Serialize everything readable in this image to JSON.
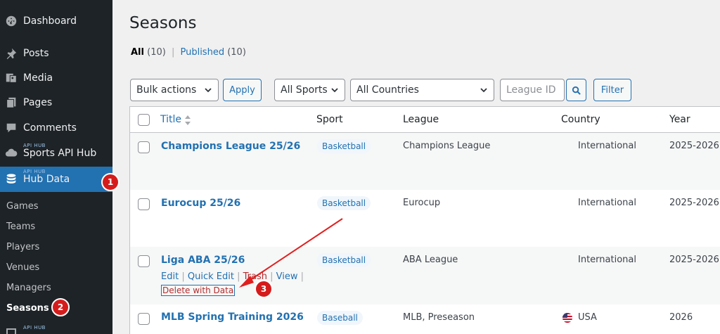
{
  "sidebar": {
    "dashboard": "Dashboard",
    "posts": "Posts",
    "media": "Media",
    "pages": "Pages",
    "comments": "Comments",
    "sports_api_hub_mini": "API HUB",
    "sports_api_hub": "Sports API Hub",
    "hub_data_mini": "API HUB",
    "hub_data": "Hub Data",
    "bottom_mini": "API HUB",
    "submenu": [
      "Games",
      "Teams",
      "Players",
      "Venues",
      "Managers",
      "Seasons"
    ],
    "current_submenu": "Seasons"
  },
  "badges": [
    "1",
    "2",
    "3"
  ],
  "page": {
    "title": "Seasons",
    "views": {
      "all_label": "All",
      "all_count": "(10)",
      "separator": "|",
      "published_label": "Published",
      "published_count": "(10)"
    }
  },
  "toolbar": {
    "bulk_actions": "Bulk actions",
    "apply": "Apply",
    "all_sports": "All Sports",
    "all_countries": "All Countries",
    "league_id_placeholder": "League ID",
    "filter": "Filter"
  },
  "table": {
    "headers": {
      "title": "Title",
      "sport": "Sport",
      "league": "League",
      "country": "Country",
      "year": "Year"
    },
    "rows": [
      {
        "title": "Champions League 25/26",
        "sport": "Basketball",
        "league": "Champions League",
        "country": "International",
        "year": "2025-2026"
      },
      {
        "title": "Eurocup 25/26",
        "sport": "Basketball",
        "league": "Eurocup",
        "country": "International",
        "year": "2025-2026"
      },
      {
        "title": "Liga ABA 25/26",
        "sport": "Basketball",
        "league": "ABA League",
        "country": "International",
        "year": "2025-2026"
      },
      {
        "title": "MLB Spring Training 2026",
        "sport": "Baseball",
        "league": "MLB, Preseason",
        "country": "USA",
        "year": "2026"
      }
    ],
    "row_actions": {
      "edit": "Edit",
      "quick_edit": "Quick Edit",
      "trash": "Trash",
      "view": "View",
      "separator": "|",
      "delete_with_data": "Delete with Data"
    }
  },
  "colors": {
    "sidebar_bg": "#1d2327",
    "accent": "#2271b1",
    "badge": "#d51c1c",
    "delete": "#b32d2e",
    "annotation_arrow": "#e02020"
  }
}
